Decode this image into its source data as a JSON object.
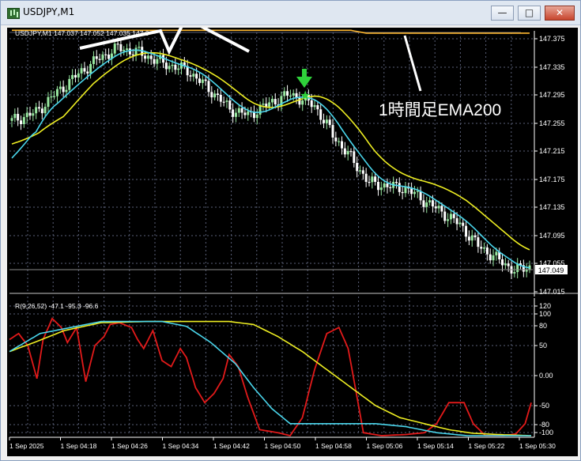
{
  "window": {
    "title": "USDJPY,M1",
    "controls": {
      "minimize": "—",
      "maximize": "□",
      "close": "✕"
    }
  },
  "main_chart": {
    "info_label": "USDJPY,M1  147.037 147.052 147.035 147.0",
    "price_ticks": [
      "147.375",
      "147.335",
      "147.295",
      "147.255",
      "147.215",
      "147.175",
      "147.135",
      "147.095",
      "147.055",
      "147.015"
    ],
    "current_price": "147.049",
    "annotation": "1時間足EMA200",
    "colors": {
      "bull": "#98e8a0",
      "bear": "#ffffff",
      "fast_ma": "#4ad6ec",
      "slow_ma": "#eeee22",
      "ema200": "#ffb830",
      "arrow": "#2fd13b",
      "grid": "#5a6078"
    }
  },
  "oscillator": {
    "label": "R(9,26,52) -47.1 -95.3 -96.6",
    "ticks": [
      "120",
      "100",
      "80",
      "50",
      "0.00",
      "-50",
      "-80",
      "-100"
    ],
    "colors": {
      "red": "#e21a1a",
      "cyan": "#4ad6ec",
      "yellow": "#eeee22"
    }
  },
  "time_axis": [
    "1 Sep 2025",
    "1 Sep 04:18",
    "1 Sep 04:26",
    "1 Sep 04:34",
    "1 Sep 04:42",
    "1 Sep 04:50",
    "1 Sep 04:58",
    "1 Sep 05:06",
    "1 Sep 05:14",
    "1 Sep 05:22",
    "1 Sep 05:30"
  ]
}
